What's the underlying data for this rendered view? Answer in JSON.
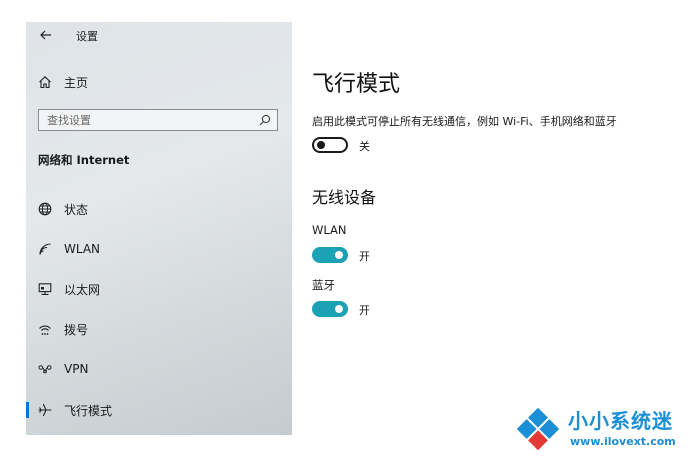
{
  "titlebar": {
    "title": "设置"
  },
  "sidebar": {
    "home_label": "主页",
    "search": {
      "placeholder": "查找设置"
    },
    "section_title": "网络和 Internet",
    "items": [
      {
        "label": "状态",
        "icon": "globe-icon"
      },
      {
        "label": "WLAN",
        "icon": "wifi-icon"
      },
      {
        "label": "以太网",
        "icon": "ethernet-icon"
      },
      {
        "label": "拨号",
        "icon": "dialup-icon"
      },
      {
        "label": "VPN",
        "icon": "vpn-icon"
      },
      {
        "label": "飞行模式",
        "icon": "airplane-icon",
        "active": true
      }
    ]
  },
  "main": {
    "title": "飞行模式",
    "description": "启用此模式可停止所有无线通信，例如 Wi-Fi、手机网络和蓝牙",
    "airplane_toggle": {
      "on": false,
      "state_label": "关"
    },
    "wireless_title": "无线设备",
    "wlan": {
      "label": "WLAN",
      "on": true,
      "state_label": "开"
    },
    "bluetooth": {
      "label": "蓝牙",
      "on": true,
      "state_label": "开"
    }
  },
  "watermark": {
    "name": "小小系统迷",
    "url": "www.ilovext.com"
  },
  "colors": {
    "accent": "#1ba2b4",
    "active_indicator": "#0078d7",
    "watermark": "#1a8fd6"
  }
}
